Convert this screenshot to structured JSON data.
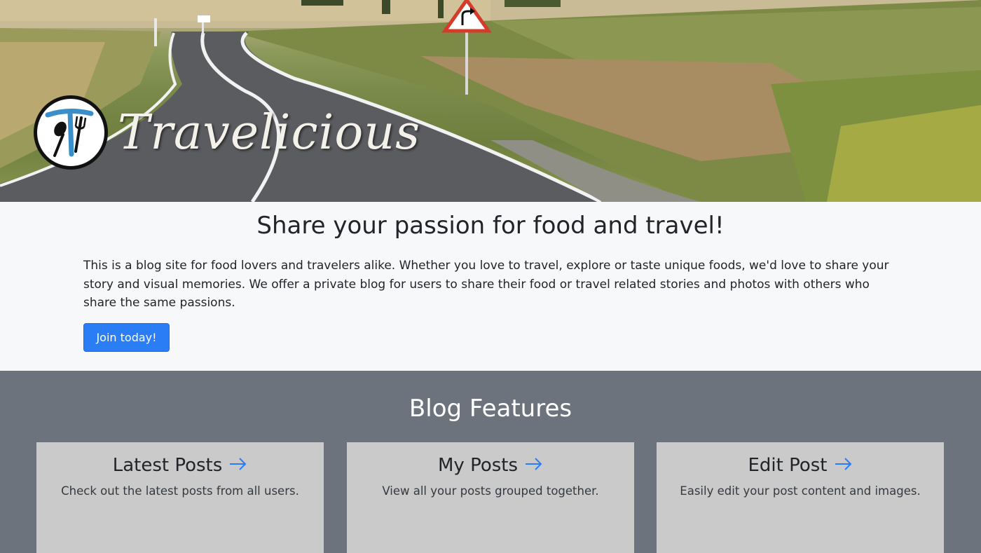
{
  "hero": {
    "site_name": "Travelicious",
    "logo_icon": "fork-spoon-t-logo",
    "sign_icon": "curve-right-warning-sign"
  },
  "intro": {
    "heading": "Share your passion for food and travel!",
    "text": "This is a blog site for food lovers and travelers alike. Whether you love to travel, explore or taste unique foods, we'd love to share your story and visual memories. We offer a private blog for users to share their food or travel related stories and photos with others who share the same passions.",
    "join_label": "Join today!"
  },
  "features": {
    "heading": "Blog Features",
    "cards": [
      {
        "title": "Latest Posts",
        "description": "Check out the latest posts from all users.",
        "icon": "arrow-right-icon"
      },
      {
        "title": "My Posts",
        "description": "View all your posts grouped together.",
        "icon": "arrow-right-icon"
      },
      {
        "title": "Edit Post",
        "description": "Easily edit your post content and images.",
        "icon": "arrow-right-icon"
      }
    ]
  },
  "colors": {
    "primary_button": "#2a7df4",
    "features_bg": "#6c737d",
    "card_bg": "#cacaca",
    "arrow": "#2a7df4"
  }
}
